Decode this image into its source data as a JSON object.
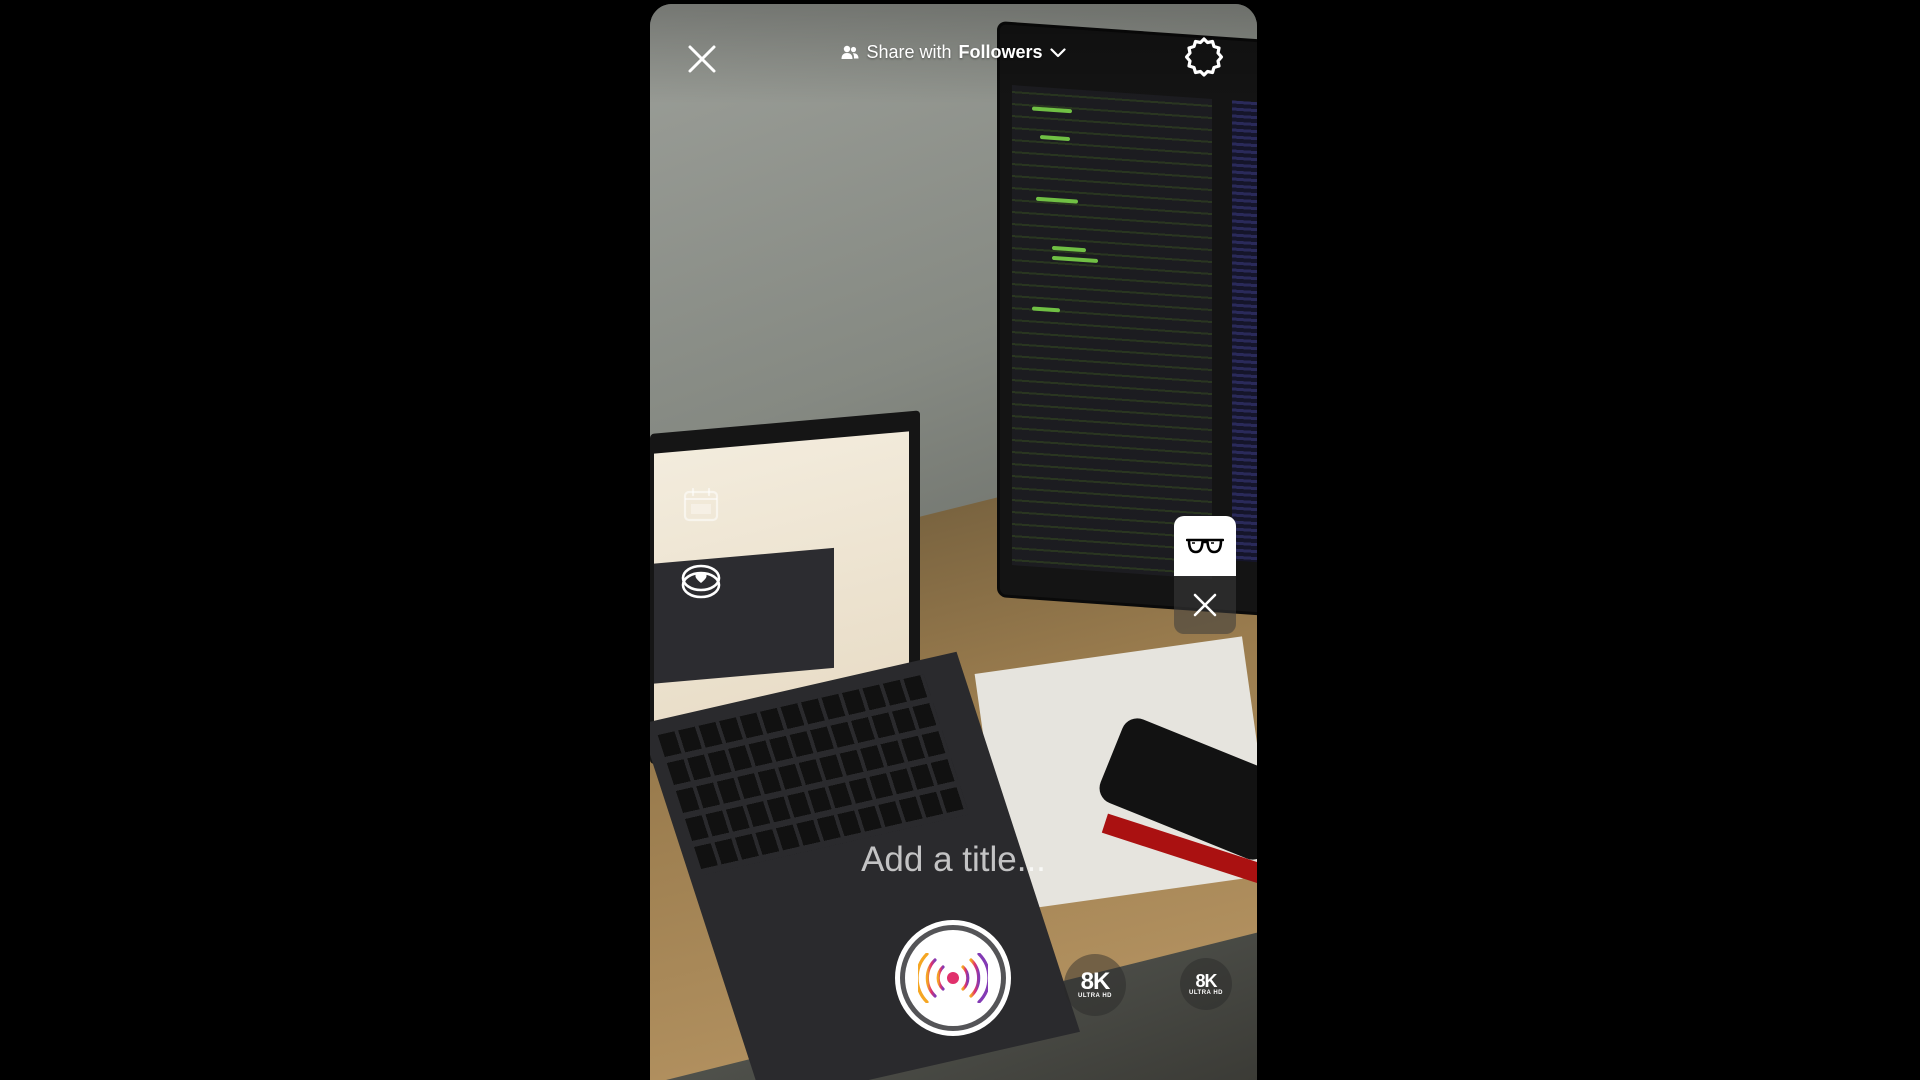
{
  "header": {
    "close_icon": "close-icon",
    "share_prefix": "Share with",
    "share_audience": "Followers",
    "audience_icon": "people-icon",
    "dropdown_icon": "chevron-down-icon",
    "settings_icon": "gear-icon"
  },
  "left_tools": {
    "schedule_icon": "calendar-icon",
    "fundraiser_icon": "heart-coin-icon"
  },
  "right_panel": {
    "filter_icon": "glasses-icon",
    "dismiss_icon": "close-icon"
  },
  "title_input": {
    "placeholder": "Add a title..."
  },
  "bottom": {
    "live_icon": "broadcast-icon",
    "effect_1": {
      "label": "8K",
      "sub": "ULTRA HD"
    },
    "effect_2": {
      "label": "8K",
      "sub": "ULTRA HD"
    }
  },
  "colors": {
    "accent_gradient": [
      "#f5a623",
      "#e1306c",
      "#833ab4"
    ],
    "ui_text": "#ffffff"
  }
}
